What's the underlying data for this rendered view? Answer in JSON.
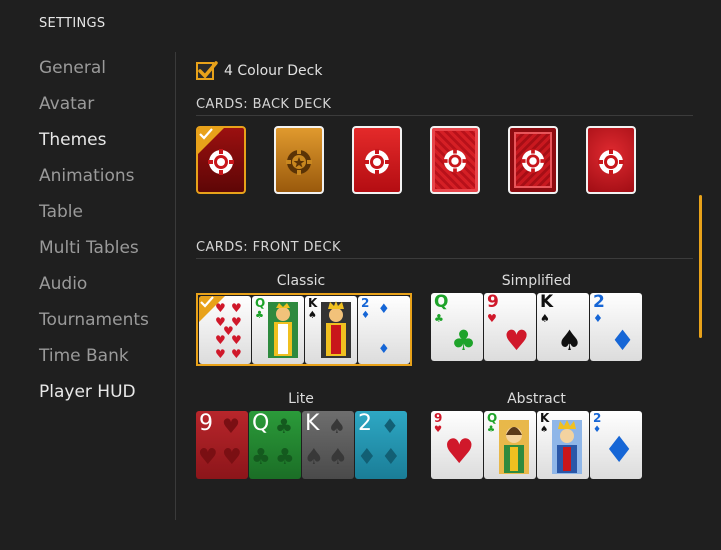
{
  "header": {
    "title": "SETTINGS"
  },
  "nav": {
    "items": [
      {
        "label": "General"
      },
      {
        "label": "Avatar"
      },
      {
        "label": "Themes"
      },
      {
        "label": "Animations"
      },
      {
        "label": "Table"
      },
      {
        "label": "Multi Tables"
      },
      {
        "label": "Audio"
      },
      {
        "label": "Tournaments"
      },
      {
        "label": "Time Bank"
      },
      {
        "label": "Player HUD"
      }
    ]
  },
  "options": {
    "four_colour_deck": {
      "label": "4 Colour Deck",
      "checked": true
    }
  },
  "back_deck": {
    "heading": "CARDS: BACK DECK",
    "cards": [
      {
        "name": "dark-red-chip",
        "selected": true
      },
      {
        "name": "orange-gold-chip",
        "selected": false
      },
      {
        "name": "red-chip",
        "selected": false
      },
      {
        "name": "red-pattern",
        "selected": false
      },
      {
        "name": "red-framed-pattern",
        "selected": false
      },
      {
        "name": "red-textured",
        "selected": false
      }
    ]
  },
  "front_deck": {
    "heading": "CARDS: FRONT DECK",
    "decks": [
      {
        "label": "Classic",
        "selected": true,
        "cards": [
          "9",
          "Q",
          "K",
          "2"
        ]
      },
      {
        "label": "Simplified",
        "selected": false,
        "cards": [
          "Q",
          "9",
          "K",
          "2"
        ]
      },
      {
        "label": "Lite",
        "selected": false,
        "cards": [
          "9",
          "Q",
          "K",
          "2"
        ]
      },
      {
        "label": "Abstract",
        "selected": false,
        "cards": [
          "9",
          "Q",
          "K",
          "2"
        ]
      }
    ]
  },
  "colors": {
    "accent": "#e8a21a",
    "background": "#1f1f1f",
    "heart": "#d0182a",
    "club": "#1ea32a",
    "diamond": "#1666d6",
    "spade": "#111111"
  }
}
